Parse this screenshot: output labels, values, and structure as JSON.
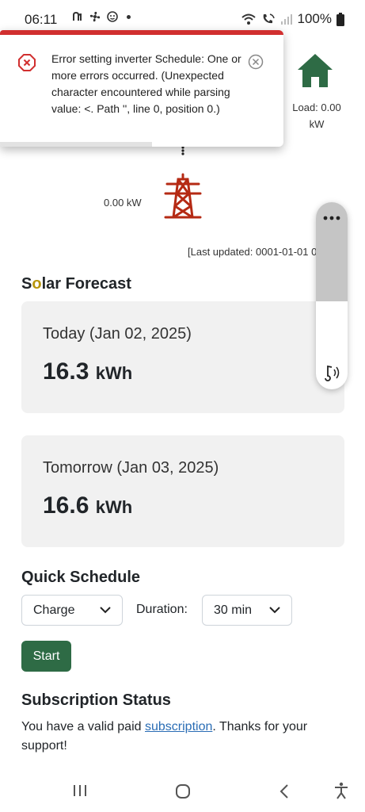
{
  "status_bar": {
    "time": "06:11",
    "battery": "100%"
  },
  "toast": {
    "type": "error",
    "message": "Error setting inverter Schedule: One or more errors occurred. (Unexpected character encountered while parsing value: <. Path '', line 0, position 0.)",
    "accent_color": "#d12f2f"
  },
  "energy": {
    "load_label": "Load: 0.00 kW",
    "grid_value": "0.00 kW",
    "last_updated": "[Last updated: 0001-01-01 0"
  },
  "solar_forecast": {
    "title_prefix": "S",
    "title_o": "o",
    "title_rest": "lar Forecast",
    "today": {
      "date_label": "Today (Jan 02, 2025)",
      "value": "16.3",
      "unit": "kWh"
    },
    "tomorrow": {
      "date_label": "Tomorrow (Jan 03, 2025)",
      "value": "16.6",
      "unit": "kWh"
    }
  },
  "quick_schedule": {
    "title": "Quick Schedule",
    "mode": "Charge",
    "duration_label": "Duration:",
    "duration": "30 min",
    "start_label": "Start"
  },
  "subscription": {
    "title": "Subscription Status",
    "text_before": "You have a valid paid ",
    "link": "subscription",
    "text_after": ". Thanks for your support!"
  },
  "volume_panel": {
    "level": 0.47
  },
  "colors": {
    "primary_green": "#2e6b45",
    "tower_red": "#b52a14",
    "error_red": "#d12f2f",
    "link_blue": "#2a6db5"
  }
}
